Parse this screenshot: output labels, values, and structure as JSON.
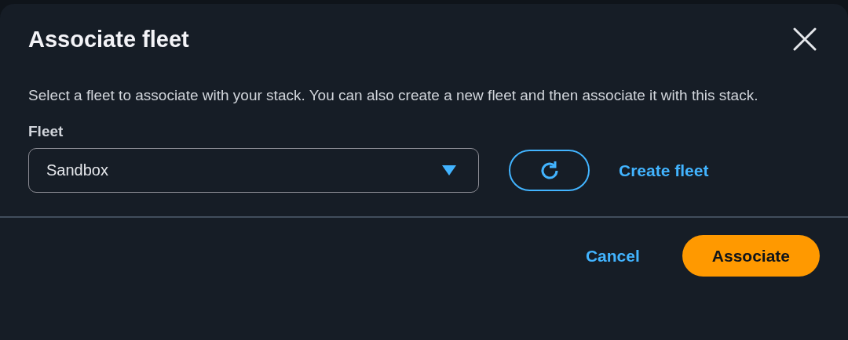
{
  "dialog": {
    "title": "Associate fleet",
    "description": "Select a fleet to associate with your stack. You can also create a new fleet and then associate it with this stack."
  },
  "field": {
    "label": "Fleet",
    "value": "Sandbox"
  },
  "create_link": "Create fleet",
  "buttons": [
    {
      "label": "Cancel",
      "kind": "link"
    },
    {
      "label": "Associate",
      "kind": "primary"
    }
  ]
}
